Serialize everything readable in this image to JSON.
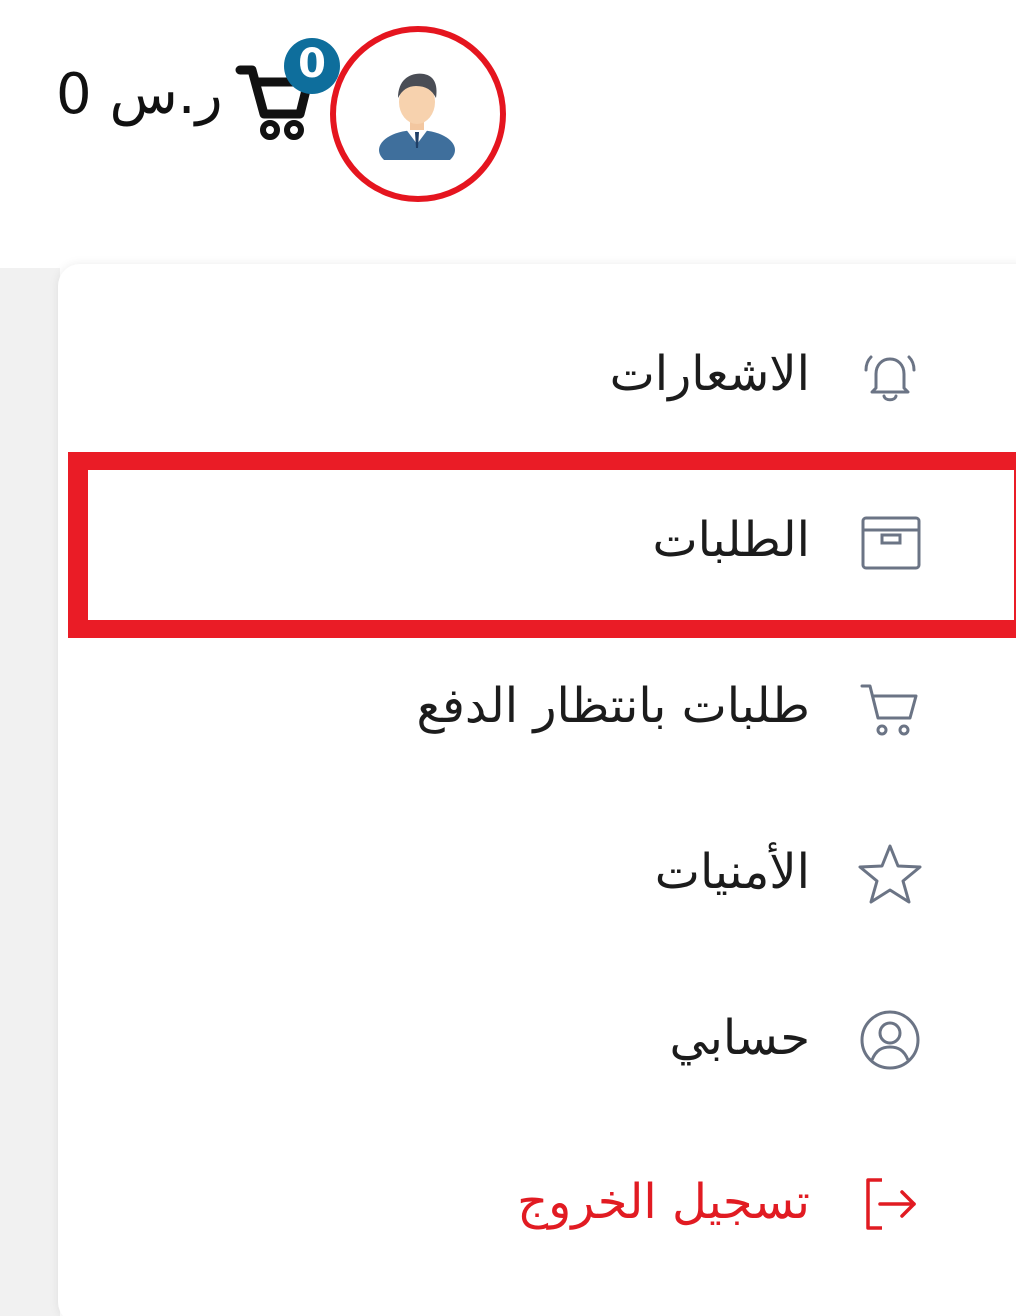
{
  "header": {
    "price": "0 ر.س",
    "cart_count": "0"
  },
  "menu": {
    "items": [
      {
        "label": "الاشعارات",
        "icon": "bell-icon"
      },
      {
        "label": "الطلبات",
        "icon": "archive-box-icon",
        "highlighted": true
      },
      {
        "label": "طلبات بانتظار الدفع",
        "icon": "cart-icon"
      },
      {
        "label": "الأمنيات",
        "icon": "star-icon"
      },
      {
        "label": "حسابي",
        "icon": "user-circle-icon"
      },
      {
        "label": "تسجيل الخروج",
        "icon": "logout-icon"
      }
    ]
  },
  "colors": {
    "highlight": "#ea1c26",
    "logout_text": "#e11b22",
    "badge": "#0e6e9c",
    "icon_stroke": "#6b7485"
  }
}
